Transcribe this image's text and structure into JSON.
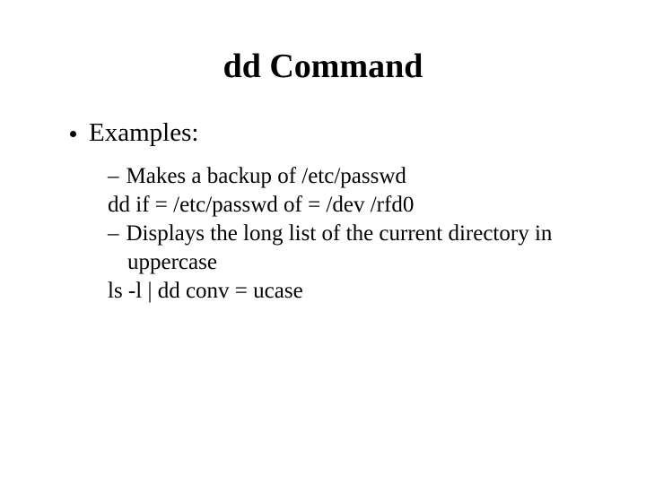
{
  "title": "dd Command",
  "bullet1": "Examples:",
  "sub": {
    "l1": "Makes a backup of  /etc/passwd",
    "l2": "dd  if = /etc/passwd of = /dev /rfd0",
    "l3": "Displays the long list of the current directory in",
    "l3b": "uppercase",
    "l4": "ls -l  | dd conv = ucase"
  },
  "dash": "–"
}
